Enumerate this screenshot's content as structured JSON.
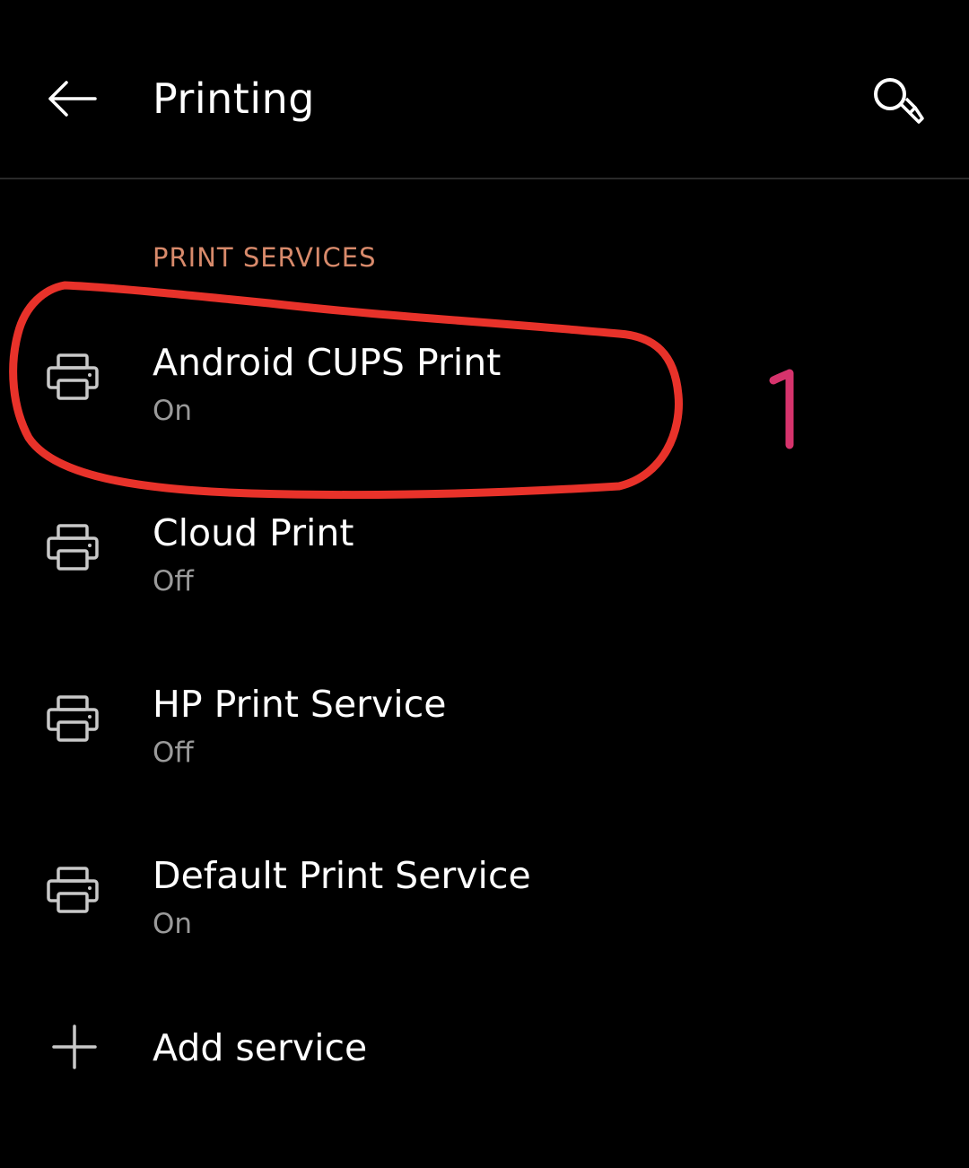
{
  "header": {
    "title": "Printing",
    "back_icon": "arrow-back-icon",
    "search_icon": "search-icon"
  },
  "section": {
    "label": "PRINT SERVICES",
    "color": "#d88a6b"
  },
  "services": [
    {
      "name": "Android CUPS Print",
      "status": "On",
      "icon": "printer-icon"
    },
    {
      "name": "Cloud Print",
      "status": "Off",
      "icon": "printer-icon"
    },
    {
      "name": "HP Print Service",
      "status": "Off",
      "icon": "printer-icon"
    },
    {
      "name": "Default Print Service",
      "status": "On",
      "icon": "printer-icon"
    }
  ],
  "add_service": {
    "label": "Add service",
    "icon": "plus-icon"
  },
  "annotation": {
    "number": "1",
    "circle_color": "#e8322a",
    "number_color": "#d6336c"
  }
}
